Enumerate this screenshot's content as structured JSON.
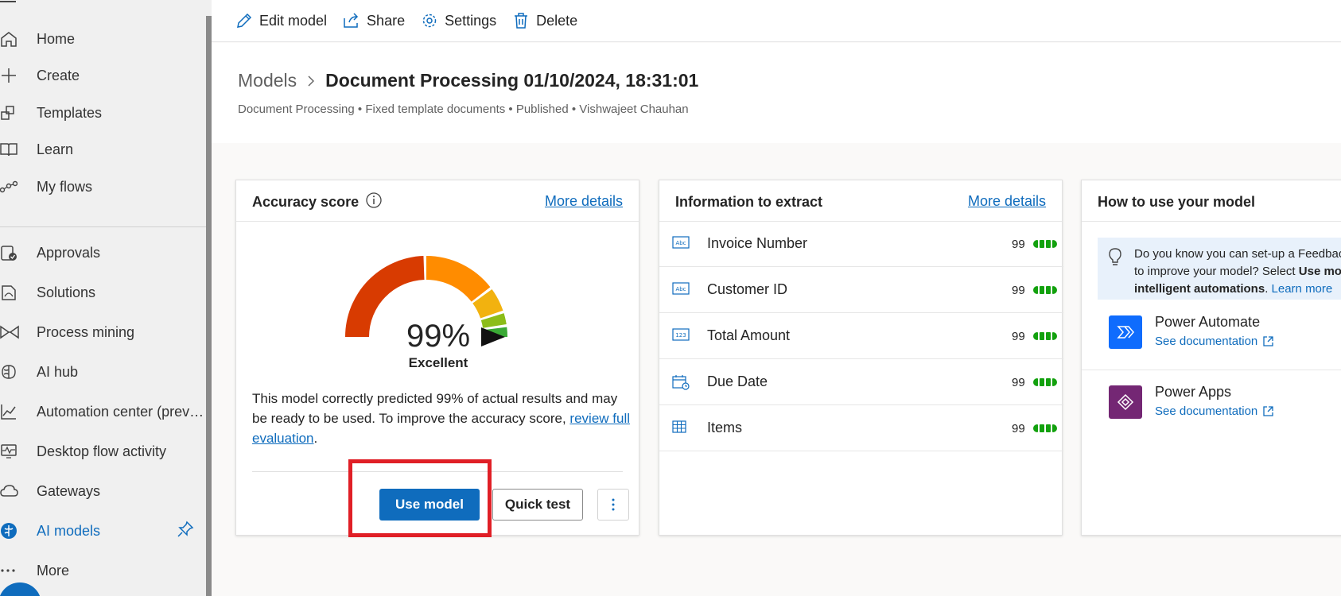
{
  "sidebar": {
    "items": [
      {
        "label": "Home",
        "icon": "home-icon"
      },
      {
        "label": "Create",
        "icon": "plus-icon"
      },
      {
        "label": "Templates",
        "icon": "templates-icon"
      },
      {
        "label": "Learn",
        "icon": "book-icon"
      },
      {
        "label": "My flows",
        "icon": "flows-icon"
      },
      {
        "label": "Approvals",
        "icon": "approvals-icon"
      },
      {
        "label": "Solutions",
        "icon": "solutions-icon"
      },
      {
        "label": "Process mining",
        "icon": "process-mining-icon"
      },
      {
        "label": "AI hub",
        "icon": "ai-hub-icon"
      },
      {
        "label": "Automation center (previe...",
        "icon": "chart-icon"
      },
      {
        "label": "Desktop flow activity",
        "icon": "monitor-icon"
      },
      {
        "label": "Gateways",
        "icon": "cloud-icon"
      },
      {
        "label": "AI models",
        "icon": "ai-models-icon",
        "active": true
      },
      {
        "label": "More",
        "icon": "more-icon"
      }
    ]
  },
  "commandbar": {
    "edit": "Edit model",
    "share": "Share",
    "settings": "Settings",
    "delete": "Delete"
  },
  "header": {
    "breadcrumb_root": "Models",
    "title": "Document Processing 01/10/2024, 18:31:01",
    "subline": "Document Processing • Fixed template documents • Published • Vishwajeet Chauhan"
  },
  "accuracy": {
    "title": "Accuracy score",
    "more_details": "More details",
    "score": "99%",
    "score_value": 99,
    "rating": "Excellent",
    "description": "This model correctly predicted 99% of actual results and may be ready to be used. To improve the accuracy score,",
    "review_link": "review full evaluation",
    "use_model": "Use model",
    "quick_test": "Quick test"
  },
  "extract": {
    "title": "Information to extract",
    "more_details": "More details",
    "fields": [
      {
        "name": "Invoice Number",
        "value": "99",
        "icon": "text-field-icon"
      },
      {
        "name": "Customer ID",
        "value": "99",
        "icon": "text-field-icon"
      },
      {
        "name": "Total Amount",
        "value": "99",
        "icon": "number-field-icon"
      },
      {
        "name": "Due Date",
        "value": "99",
        "icon": "date-field-icon"
      },
      {
        "name": "Items",
        "value": "99",
        "icon": "table-field-icon"
      }
    ]
  },
  "howto": {
    "title": "How to use your model",
    "tip_line1": "Do you know you can set-up a Feedbac",
    "tip_line2_pre": "to improve your model? Select ",
    "tip_line2_bold": "Use mo",
    "tip_line3_bold": "intelligent automations",
    "tip_line3_link": "Learn more",
    "apps": [
      {
        "name": "Power Automate",
        "link": "See documentation",
        "color": "#0f6cfd"
      },
      {
        "name": "Power Apps",
        "link": "See documentation",
        "color": "#742774"
      }
    ]
  },
  "colors": {
    "accent": "#0f6cbd",
    "highlight": "#e01f26",
    "bar_green": "#13a10e"
  }
}
